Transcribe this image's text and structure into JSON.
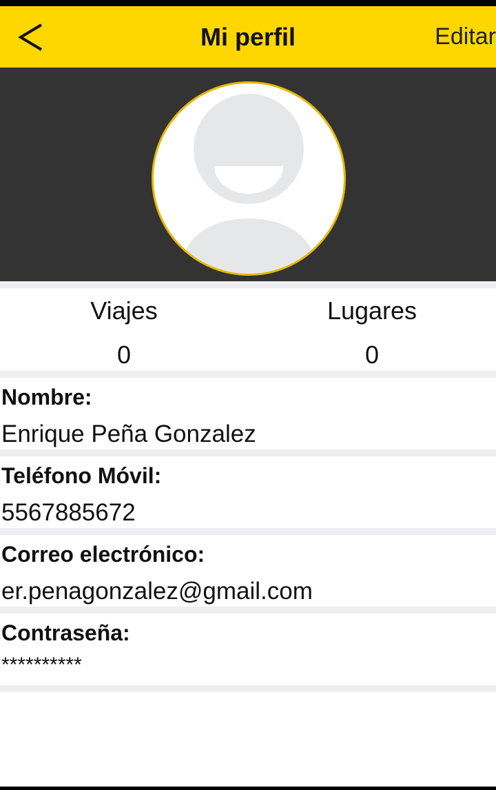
{
  "header": {
    "back_icon": "chevron-left-icon",
    "title": "Mi perfil",
    "edit_label": "Editar"
  },
  "profile": {
    "avatar_icon": "user-placeholder-icon",
    "border_color": "#e6b800"
  },
  "stats": [
    {
      "label": "Viajes",
      "value": "0"
    },
    {
      "label": "Lugares",
      "value": "0"
    }
  ],
  "fields": [
    {
      "label": "Nombre:",
      "value": "Enrique Peña Gonzalez"
    },
    {
      "label": "Teléfono Móvil:",
      "value": "5567885672"
    },
    {
      "label": "Correo electrónico:",
      "value": "er.penagonzalez@gmail.com"
    },
    {
      "label": "Contraseña:",
      "value": "**********"
    }
  ],
  "colors": {
    "accent": "#ffd700",
    "banner": "#333333",
    "separator": "#eeeef2"
  }
}
